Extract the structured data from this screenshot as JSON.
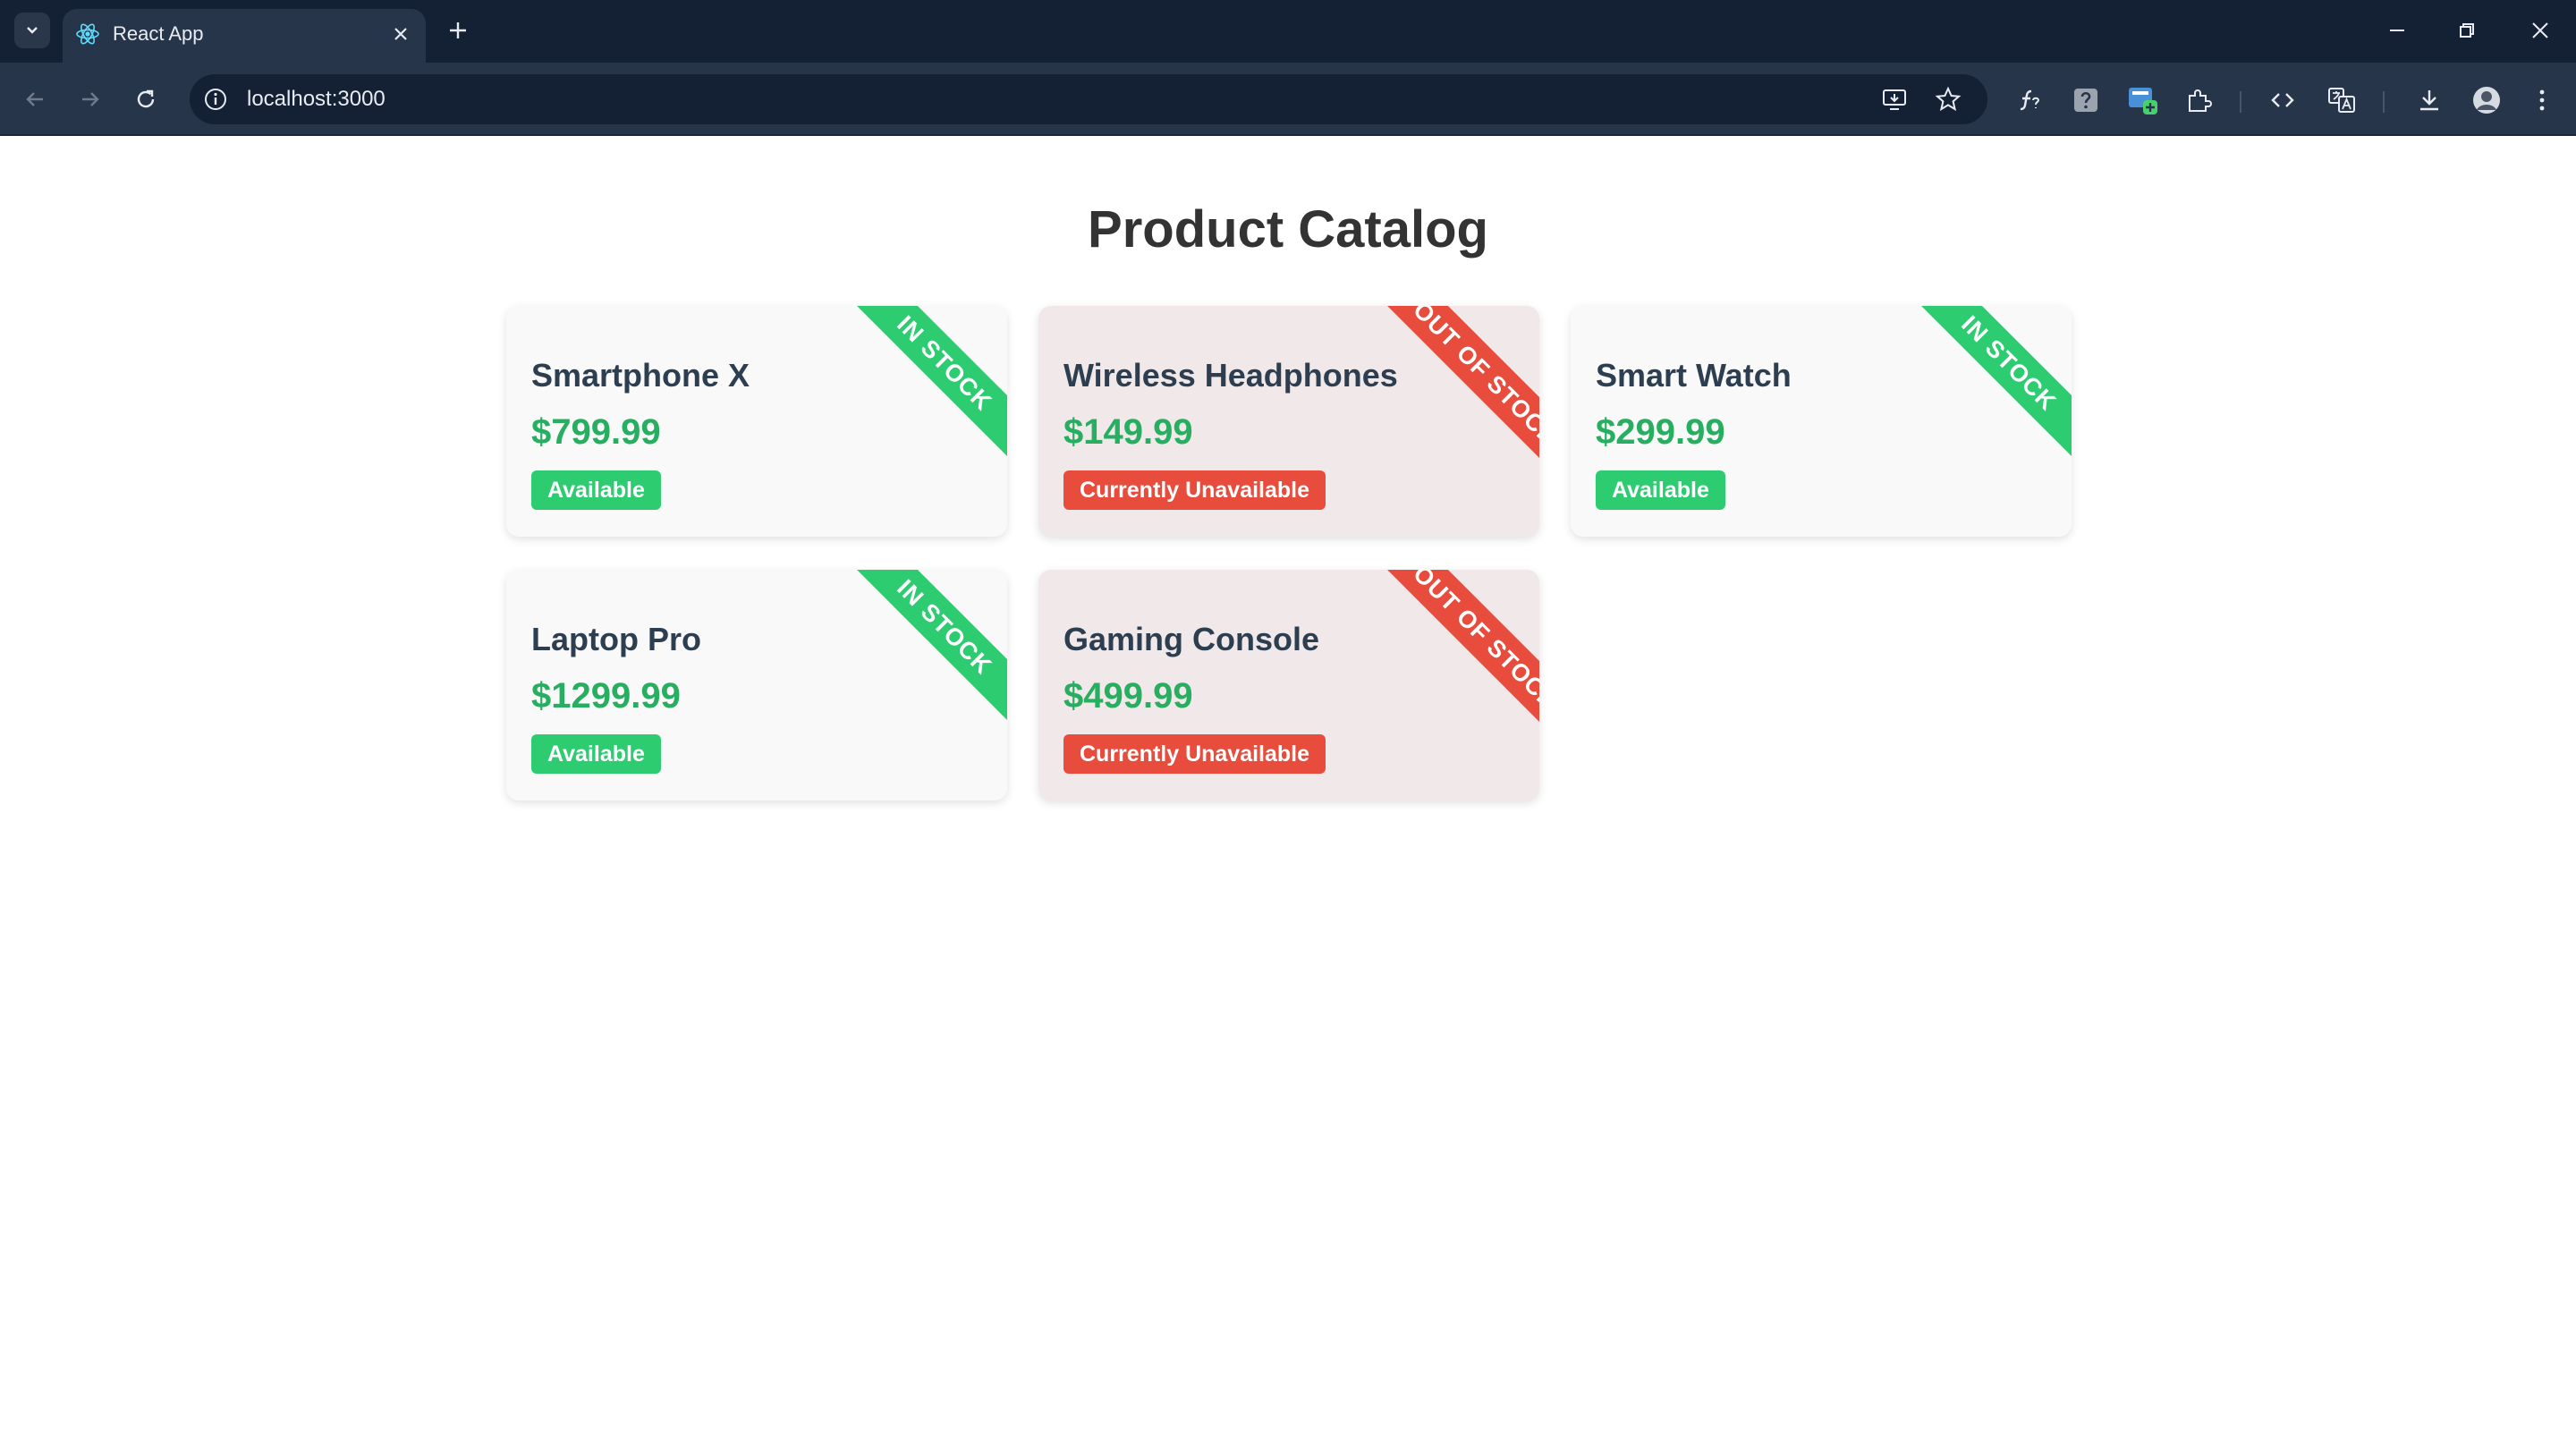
{
  "browser": {
    "tab": {
      "title": "React App"
    },
    "address": {
      "url": "localhost:3000"
    },
    "colors": {
      "frame": "#142033",
      "toolbar": "#27354a"
    }
  },
  "page": {
    "title": "Product Catalog"
  },
  "products": [
    {
      "name": "Smartphone X",
      "price": "$799.99",
      "badge": "Available",
      "ribbon": "IN STOCK",
      "status": "in"
    },
    {
      "name": "Wireless Headphones",
      "price": "$149.99",
      "badge": "Currently Unavailable",
      "ribbon": "OUT OF STOCK",
      "status": "out"
    },
    {
      "name": "Smart Watch",
      "price": "$299.99",
      "badge": "Available",
      "ribbon": "IN STOCK",
      "status": "in"
    },
    {
      "name": "Laptop Pro",
      "price": "$1299.99",
      "badge": "Available",
      "ribbon": "IN STOCK",
      "status": "in"
    },
    {
      "name": "Gaming Console",
      "price": "$499.99",
      "badge": "Currently Unavailable",
      "ribbon": "OUT OF STOCK",
      "status": "out"
    }
  ],
  "colors": {
    "title": "#333333",
    "name": "#2c3e50",
    "price": "#27ae60",
    "in_stock": "#2ecc71",
    "out_of_stock": "#e74c3c",
    "card_in": "#f9f9f9",
    "card_out": "#f1e9e9"
  }
}
